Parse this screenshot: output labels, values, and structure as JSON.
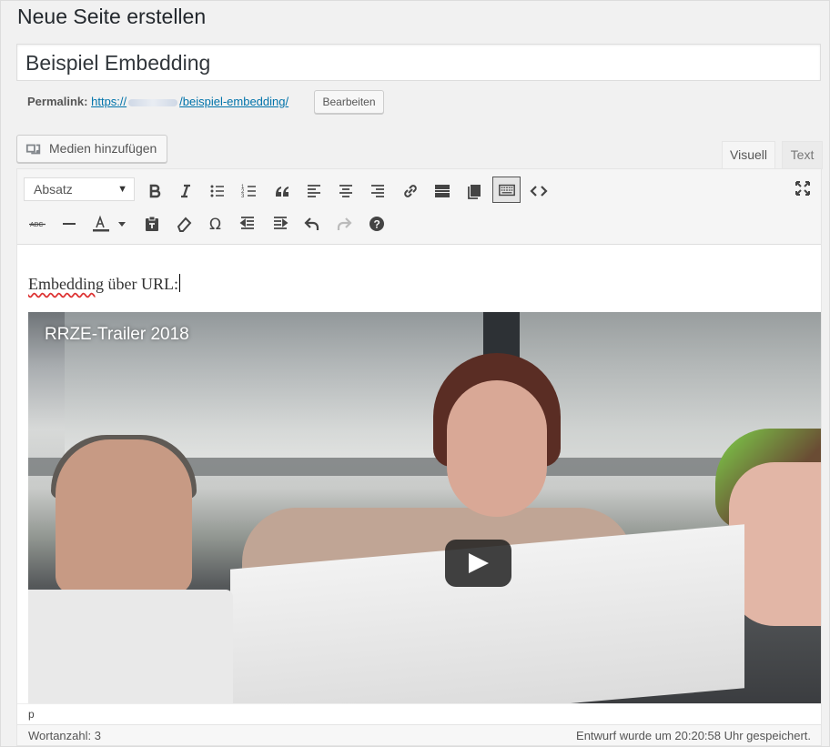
{
  "page": {
    "title": "Neue Seite erstellen"
  },
  "post": {
    "title": "Beispiel Embedding"
  },
  "permalink": {
    "label": "Permalink:",
    "url_prefix": "https://",
    "url_slug": "/beispiel-embedding/",
    "edit_label": "Bearbeiten"
  },
  "media": {
    "add_label": "Medien hinzufügen"
  },
  "tabs": {
    "visual": "Visuell",
    "text": "Text"
  },
  "toolbar": {
    "format_select": "Absatz",
    "row1": [
      "bold-icon",
      "italic-icon",
      "bullet-list-icon",
      "numbered-list-icon",
      "blockquote-icon",
      "align-left-icon",
      "align-center-icon",
      "align-right-icon",
      "link-icon",
      "read-more-icon",
      "page-break-icon",
      "toolbar-toggle-icon",
      "code-icon"
    ],
    "row2": [
      "strikethrough-icon",
      "horizontal-line-icon",
      "text-color-icon",
      "paste-text-icon",
      "clear-formatting-icon",
      "special-character-icon",
      "outdent-icon",
      "indent-icon",
      "undo-icon",
      "redo-icon",
      "help-icon"
    ],
    "fullscreen": "fullscreen-icon"
  },
  "content": {
    "paragraph": "Embedding über URL:",
    "paragraph_underlined": "Embedding",
    "paragraph_rest": " über URL:"
  },
  "video": {
    "title": "RRZE-Trailer 2018",
    "play_icon": "play-icon"
  },
  "status": {
    "path": "p"
  },
  "footer": {
    "word_count": "Wortanzahl: 3",
    "saved": "Entwurf wurde um 20:20:58 Uhr gespeichert."
  }
}
